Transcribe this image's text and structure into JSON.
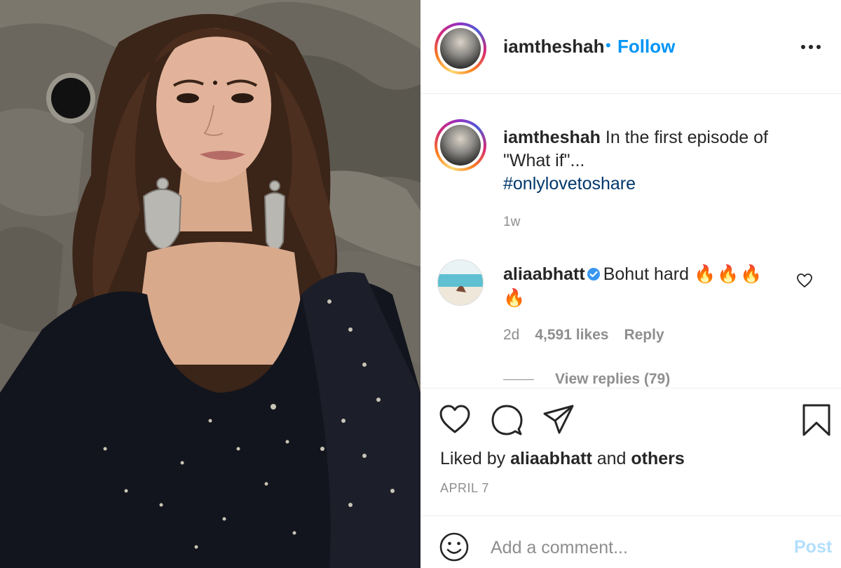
{
  "post": {
    "author": "iamtheshah",
    "follow_dot": "•",
    "follow_label": "Follow",
    "more_icon": "more-horizontal-icon"
  },
  "caption": {
    "username": "iamtheshah",
    "text": "In the first episode of \"What if\"...",
    "hashtag": "#onlylovetoshare",
    "time": "1w"
  },
  "comment": {
    "username": "aliaabhatt",
    "verified": true,
    "text": "Bohut hard",
    "emoji": "🔥🔥🔥🔥",
    "time": "2d",
    "likes": "4,591 likes",
    "reply_label": "Reply",
    "view_replies": "View replies (79)"
  },
  "actions": {
    "icons": [
      "heart-icon",
      "comment-icon",
      "share-icon",
      "bookmark-icon"
    ]
  },
  "likes": {
    "prefix": "Liked by",
    "user": "aliaabhatt",
    "and": "and",
    "others": "others"
  },
  "date": "APRIL 7",
  "add_comment": {
    "placeholder": "Add a comment...",
    "post_label": "Post"
  },
  "colors": {
    "link_blue": "#0095f6",
    "hashtag": "#00376b",
    "muted": "#8e8e8e",
    "fire": "#f5a623",
    "post_disabled": "#b2dffc"
  }
}
